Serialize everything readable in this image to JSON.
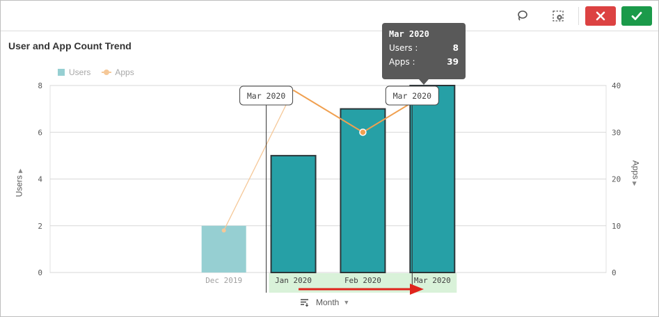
{
  "toolbar": {
    "lasso_icon": "lasso-icon",
    "clear_selection_icon": "clear-selection-icon",
    "cancel_icon": "close-icon",
    "confirm_icon": "check-icon",
    "cancel_color": "#dc4242",
    "confirm_color": "#1b9a4a"
  },
  "title": "User and App Count Trend",
  "dimension_label": "Month",
  "tooltip": {
    "header": "Mar 2020",
    "rows": [
      {
        "label": "Users :",
        "value": "8"
      },
      {
        "label": "Apps :",
        "value": "39"
      }
    ]
  },
  "range_bubbles": {
    "start": "Mar 2020",
    "end": "Mar 2020"
  },
  "chart_data": {
    "type": "bar",
    "categories": [
      "Dec 2019",
      "Jan 2020",
      "Feb 2020",
      "Mar 2020"
    ],
    "series": [
      {
        "name": "Users",
        "type": "bar",
        "axis": "left",
        "values": [
          2,
          5,
          7,
          8
        ],
        "color": "#26a0a6",
        "dimmed_color": "#96cfd2"
      },
      {
        "name": "Apps",
        "type": "line",
        "axis": "right",
        "values": [
          9,
          39,
          30,
          39
        ],
        "color": "#f0a050",
        "dimmed_color": "#f5c898"
      }
    ],
    "selected": [
      false,
      true,
      true,
      true
    ],
    "ylabel": "Users",
    "y2label": "Apps",
    "ylim": [
      0,
      8
    ],
    "y2lim": [
      0,
      40
    ],
    "yticks": [
      0,
      2,
      4,
      6,
      8
    ],
    "y2ticks": [
      0,
      10,
      20,
      30,
      40
    ],
    "grid": true,
    "legend": "top-left",
    "selection_color": "#d9f2d9",
    "annotation": "red arrow pointing right under selected range"
  }
}
